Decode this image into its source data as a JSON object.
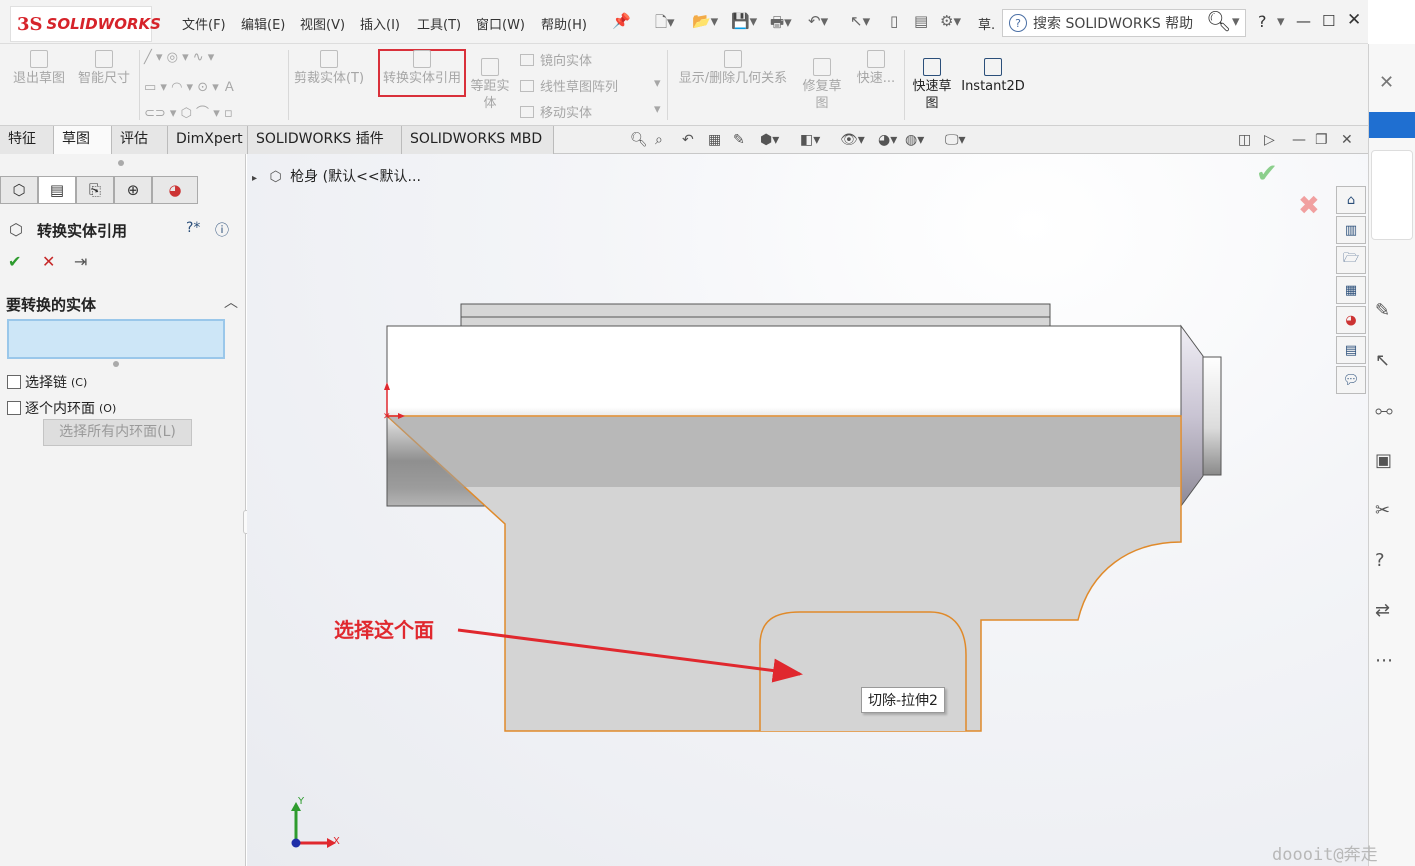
{
  "app": {
    "logo": "SOLIDWORKS",
    "logo_mark": "3S"
  },
  "menus": [
    "文件(F)",
    "编辑(E)",
    "视图(V)",
    "插入(I)",
    "工具(T)",
    "窗口(W)",
    "帮助(H)"
  ],
  "titlebar": {
    "truncated_label": "草.",
    "search_placeholder": "搜索 SOLIDWORKS 帮助",
    "help": "?"
  },
  "ribbon": {
    "exit_sketch": "退出草图",
    "smart_dimension": "智能尺寸",
    "trim_entities": "剪裁实体(T)",
    "convert_entities": "转换实体引用",
    "offset_line1": "等距实",
    "offset_line2": "体",
    "mirror": "镜向实体",
    "linear_pattern": "线性草图阵列",
    "move": "移动实体",
    "display_relations": "显示/删除几何关系",
    "repair_line1": "修复草",
    "repair_line2": "图",
    "quick_snaps": "快速...",
    "rapid_sketch_line1": "快速草",
    "rapid_sketch_line2": "图",
    "instant2d": "Instant2D"
  },
  "tabs": [
    "特征",
    "草图",
    "评估",
    "DimXpert",
    "SOLIDWORKS 插件",
    "SOLIDWORKS MBD"
  ],
  "active_tab": "草图",
  "property_manager": {
    "title": "转换实体引用",
    "section_title": "要转换的实体",
    "chain_label": "选择链",
    "chain_mnemonic": "(C)",
    "inner_loops_label": "逐个内环面",
    "inner_loops_mnemonic": "(O)",
    "select_all_label": "选择所有内环面(L)"
  },
  "tree": {
    "part_label": "枪身 (默认<<默认..."
  },
  "viewport": {
    "tooltip": "切除-拉伸2",
    "annotation": "选择这个面",
    "triad_x": "X",
    "triad_y": "Y",
    "watermark": "doooit@奔走"
  },
  "colors": {
    "accent_red": "#e0282e",
    "edge_orange": "#e08a2a",
    "selection_blue": "#cde6f7"
  }
}
